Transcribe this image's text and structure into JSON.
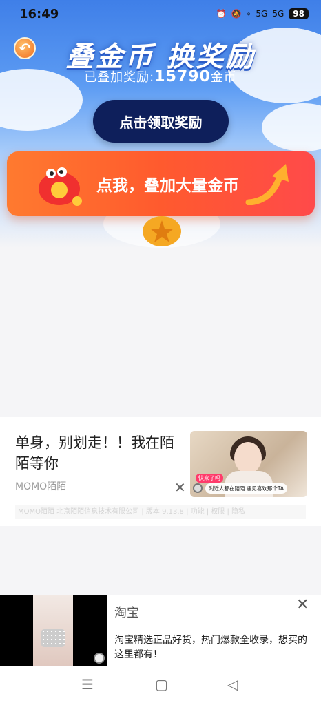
{
  "status_bar": {
    "time": "16:49",
    "signal1": "5G",
    "signal2": "5G",
    "battery": "98"
  },
  "hero": {
    "title": "叠金币  换奖励",
    "subtitle_prefix": "已叠加奖励:",
    "subtitle_amount": "15790",
    "subtitle_unit": "金币",
    "claim_button": "点击领取奖励",
    "stack_button": "点我，叠加大量金币"
  },
  "ad1": {
    "text": "单身，别划走！！我在陌陌等你",
    "source": "MOMO陌陌",
    "image_tag1": "快来了吗",
    "image_tag2": "附近人都在陌陌  遇见喜欢那个TA",
    "info": "MOMO陌陌 北京陌陌信息技术有限公司 | 版本 9.13.8 | 功能 | 权限 | 隐私"
  },
  "ad2": {
    "title": "淘宝",
    "description": "淘宝精选正品好货，热门爆款全收录，想买的这里都有！"
  },
  "nav": {
    "menu": "☰",
    "home": "▢",
    "back": "◁"
  },
  "icons": {
    "back": "back-arrow-icon",
    "close": "close-icon",
    "alarm": "alarm-icon",
    "mute": "mute-icon",
    "location": "location-icon"
  }
}
